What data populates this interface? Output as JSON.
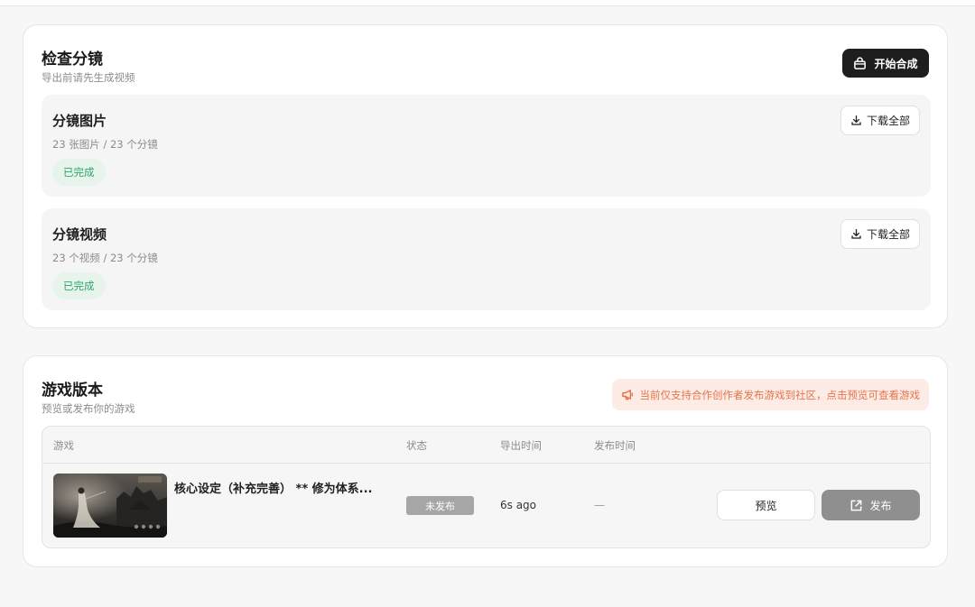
{
  "storyboard": {
    "title": "检查分镜",
    "subtitle": "导出前请先生成视频",
    "compose_button": "开始合成",
    "compose_icon": "bag-icon",
    "sections": [
      {
        "title": "分镜图片",
        "summary": "23 张图片 / 23 个分镜",
        "status": "已完成",
        "download_label": "下载全部"
      },
      {
        "title": "分镜视频",
        "summary": "23 个视频 / 23 个分镜",
        "status": "已完成",
        "download_label": "下载全部"
      }
    ]
  },
  "game_versions": {
    "title": "游戏版本",
    "subtitle": "预览或发布你的游戏",
    "notice": "当前仅支持合作创作者发布游戏到社区，点击预览可查看游戏",
    "columns": [
      "游戏",
      "状态",
      "导出时间",
      "发布时间"
    ],
    "rows": [
      {
        "name": "核心设定（补充完善） ** 修为体系...",
        "status": "未发布",
        "export_time": "6s ago",
        "publish_time": "—",
        "preview_label": "预览",
        "publish_label": "发布"
      }
    ]
  },
  "colors": {
    "primary_dark": "#1e1e1e",
    "success_bg": "#e7f4ec",
    "success_text": "#2fa56a",
    "notice_bg": "#fdece5",
    "notice_text": "#e8734a",
    "disabled": "#8f8f8f"
  }
}
